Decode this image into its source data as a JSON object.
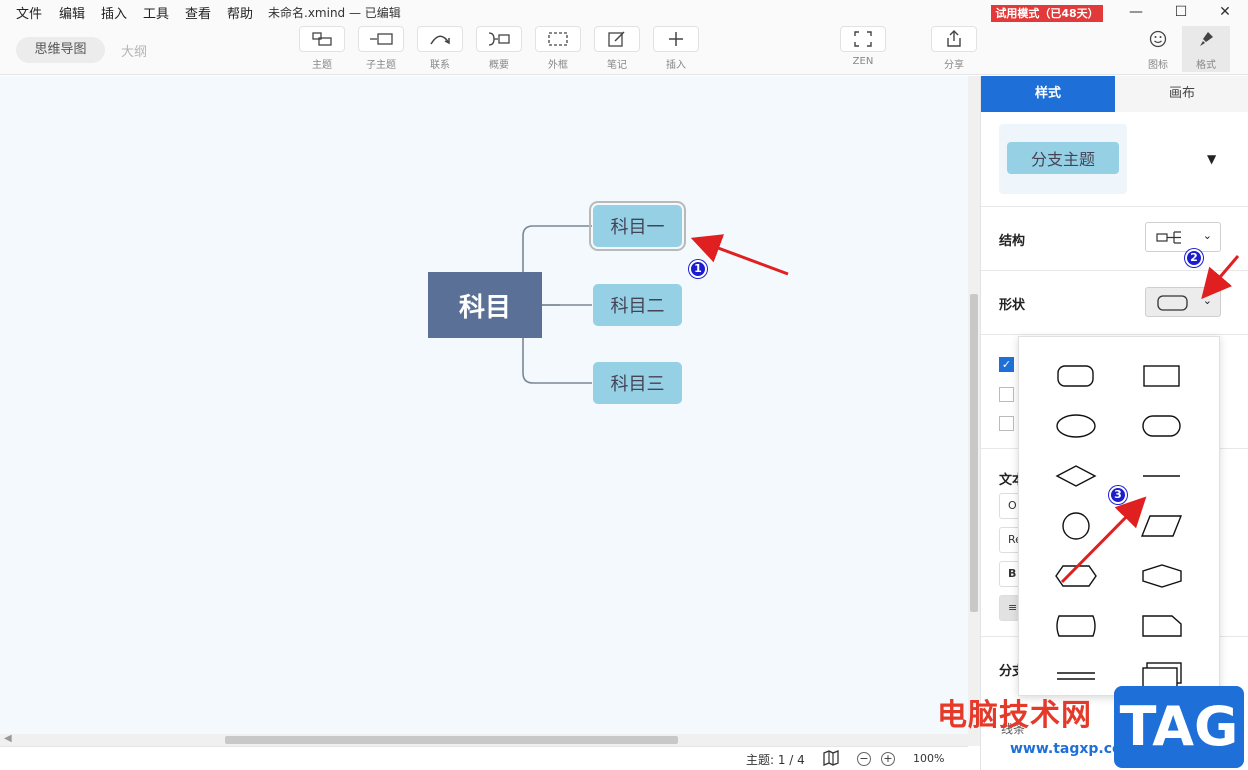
{
  "menu": {
    "items": [
      "文件",
      "编辑",
      "插入",
      "工具",
      "查看",
      "帮助"
    ],
    "file_title": "未命名.xmind — 已编辑",
    "trial_badge": "试用模式（已48天）"
  },
  "window_controls": {
    "minimize": "—",
    "maximize": "☐",
    "close": "✕"
  },
  "toolbar": {
    "view_mindmap": "思维导图",
    "view_outline": "大纲",
    "buttons": [
      {
        "label": "主题",
        "icon": "topic-icon"
      },
      {
        "label": "子主题",
        "icon": "subtopic-icon"
      },
      {
        "label": "联系",
        "icon": "relationship-icon"
      },
      {
        "label": "概要",
        "icon": "summary-icon"
      },
      {
        "label": "外框",
        "icon": "boundary-icon"
      },
      {
        "label": "笔记",
        "icon": "note-icon"
      },
      {
        "label": "插入",
        "icon": "insert-icon"
      },
      {
        "label": "ZEN",
        "icon": "zen-icon"
      },
      {
        "label": "分享",
        "icon": "share-icon"
      }
    ],
    "icon_panel_label": "图标",
    "format_panel_label": "格式"
  },
  "mindmap": {
    "central": "科目",
    "branches": [
      "科目一",
      "科目二",
      "科目三"
    ],
    "selected_index": 0,
    "central_color": "#5b7096",
    "branch_color": "#95d0e5"
  },
  "statusbar": {
    "topic_count": "主题: 1 / 4",
    "zoom_minus": "−",
    "zoom_plus": "+",
    "zoom": "100%"
  },
  "panel": {
    "tab_style": "样式",
    "tab_canvas": "画布",
    "style_preview": "分支主题",
    "structure_label": "结构",
    "shape_label": "形状",
    "text_label_partial": "文本",
    "font_partial": "O",
    "font2_partial": "Re",
    "bold_partial": "B",
    "align_partial": "≡",
    "branch_label_partial": "分支",
    "line_label_partial": "线条",
    "accent": "#1f6fd8"
  },
  "shape_menu": {
    "options": [
      "rounded-rect",
      "rect",
      "ellipse",
      "pill",
      "diamond",
      "underline",
      "circle",
      "parallelogram",
      "hexagon",
      "long-hexagon",
      "bulge-rect",
      "cut-corner-rect",
      "double-line",
      "stacked-rect"
    ]
  },
  "annotations": {
    "badge1": "1",
    "badge2": "2",
    "badge3": "3",
    "arrow_color": "#e02020"
  },
  "watermark": {
    "site_name": "电脑技术网",
    "url": "www.tagxp.com",
    "tag": "TAG"
  }
}
